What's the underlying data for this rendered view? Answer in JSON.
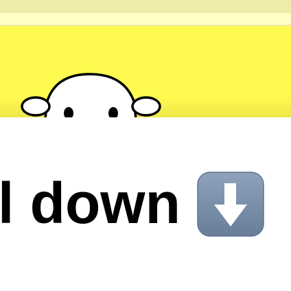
{
  "header": {
    "colors": {
      "top_band": "#EEECA6",
      "second_band": "#FFFFC6",
      "brand_yellow": "#FFFA50"
    }
  },
  "hero": {
    "mascot_icon": "ghost-icon"
  },
  "caption": {
    "text": "l down",
    "emoji_icon": "down-arrow-icon",
    "emoji_color": "#7A8FAA"
  }
}
